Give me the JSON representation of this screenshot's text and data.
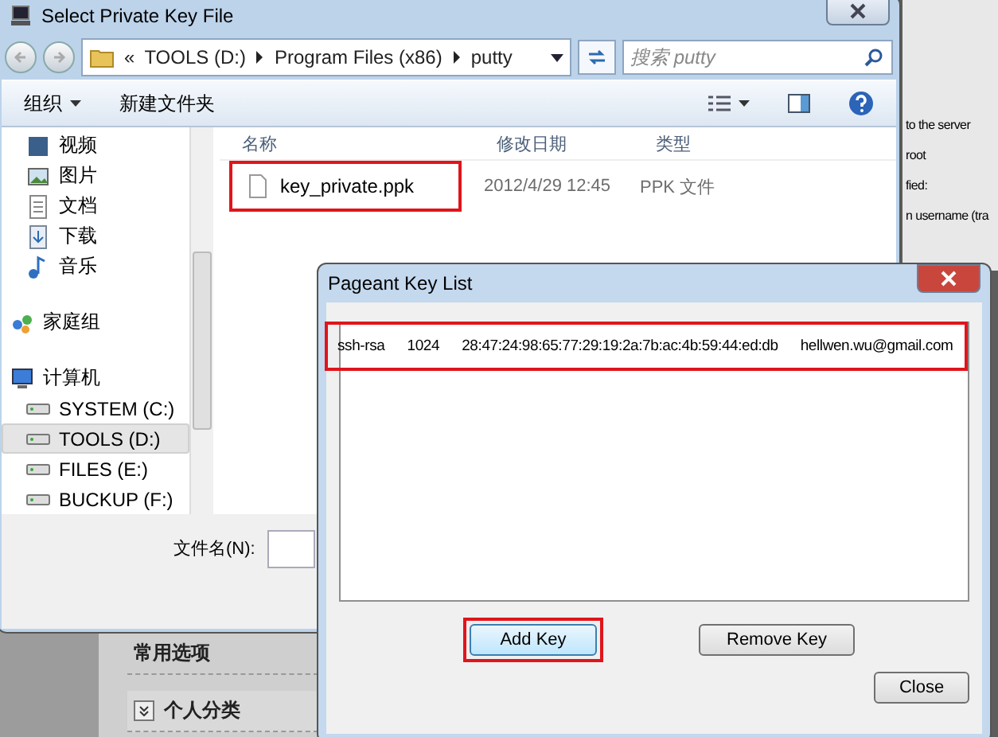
{
  "background_app": {
    "right_texts": [
      "to the server",
      "root",
      "fied:",
      "n username (tra"
    ],
    "sections": [
      {
        "label": "常用选项",
        "kind": "heading"
      },
      {
        "label": "个人分类",
        "kind": "collapsible"
      }
    ]
  },
  "file_dialog": {
    "title": "Select Private Key File",
    "breadcrumb": [
      "TOOLS (D:)",
      "Program Files (x86)",
      "putty"
    ],
    "overflow_mark": "«",
    "search": {
      "placeholder": "搜索 putty"
    },
    "toolbar": [
      {
        "label": "组织",
        "dropdown": true
      },
      {
        "label": "新建文件夹",
        "dropdown": false
      }
    ],
    "nav": [
      {
        "label": "视频",
        "kind": "video",
        "selected": false
      },
      {
        "label": "图片",
        "kind": "picture",
        "selected": false
      },
      {
        "label": "文档",
        "kind": "document",
        "selected": false
      },
      {
        "label": "下载",
        "kind": "download",
        "selected": false
      },
      {
        "label": "音乐",
        "kind": "music",
        "selected": false
      },
      {
        "label": "家庭组",
        "kind": "homegroup",
        "selected": false
      },
      {
        "label": "计算机",
        "kind": "computer",
        "selected": false,
        "children": [
          {
            "label": "SYSTEM (C:)",
            "kind": "drive",
            "selected": false
          },
          {
            "label": "TOOLS (D:)",
            "kind": "drive",
            "selected": true
          },
          {
            "label": "FILES (E:)",
            "kind": "drive",
            "selected": false
          },
          {
            "label": "BUCKUP (F:)",
            "kind": "drive",
            "selected": false
          }
        ]
      }
    ],
    "columns": [
      "名称",
      "修改日期",
      "类型"
    ],
    "files": [
      {
        "name": "key_private.ppk",
        "modified": "2012/4/29 12:45",
        "type": "PPK 文件",
        "highlighted": true
      }
    ],
    "filename_label": "文件名(N):"
  },
  "pageant": {
    "title": "Pageant Key List",
    "keys": [
      {
        "algorithm": "ssh-rsa",
        "bits": "1024",
        "fingerprint": "28:47:24:98:65:77:29:19:2a:7b:ac:4b:59:44:ed:db",
        "comment": "hellwen.wu@gmail.com",
        "highlighted": true
      }
    ],
    "buttons": [
      {
        "label": "Add Key",
        "highlighted": true,
        "focused": true
      },
      {
        "label": "Remove Key",
        "highlighted": false,
        "focused": false
      }
    ],
    "close_button": "Close"
  }
}
